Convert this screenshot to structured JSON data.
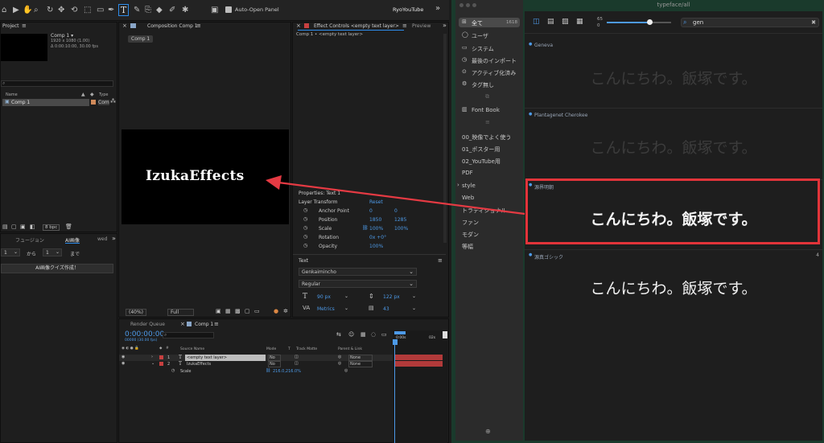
{
  "toolbar": {
    "auto_open_label": "Auto-Open Panel",
    "workspace_tab": "RyoYouTube",
    "more": "»"
  },
  "project": {
    "title": "Project",
    "comp_name": "Comp 1 ▾",
    "comp_dims": "1920 x 1080 (1.00)",
    "comp_duration": "Δ 0:00:10:00, 30.00 fps",
    "search_placeholder": "",
    "col_name": "Name",
    "col_type": "Type",
    "item_name": "Comp 1",
    "item_type": "Com",
    "bpc": "8 bpc"
  },
  "fusion_panel": {
    "tab1": "フュージョン",
    "tab2": "AI画像",
    "tab3": "wed",
    "more": "»",
    "from_val": "1",
    "from_label": "から",
    "to_val": "1",
    "to_label": "まで",
    "action": "AI画像クイズ作成！"
  },
  "composition": {
    "tab": "Composition Comp 1",
    "comp_chip": "Comp 1",
    "canvas_text": "IzukaEffects",
    "zoom": "(40%)",
    "quality": "Full"
  },
  "effect_controls": {
    "tab": "Effect Controls <empty text layer>",
    "preview_tab": "Preview",
    "breadcrumb": "Comp 1 • <empty text layer>"
  },
  "properties": {
    "title": "Properties: Text 1",
    "section": "Layer Transform",
    "reset": "Reset",
    "rows": [
      {
        "label": "Anchor Point",
        "v1": "0",
        "v2": "0"
      },
      {
        "label": "Position",
        "v1": "1850",
        "v2": "1285"
      },
      {
        "label": "Scale",
        "v1": "100%",
        "v2": "100%"
      },
      {
        "label": "Rotation",
        "v1": "0x +0°",
        "v2": ""
      },
      {
        "label": "Opacity",
        "v1": "100%",
        "v2": ""
      }
    ],
    "text_section": "Text",
    "font": "Genkaimincho",
    "style": "Regular",
    "size": "90 px",
    "leading": "122 px",
    "kerning": "Metrics",
    "tracking": "43"
  },
  "timeline": {
    "render_queue": "Render Queue",
    "comp_tab": "Comp 1",
    "timecode": "0:00:00:00",
    "frames": "00000 (30.00 fps)",
    "cols": {
      "source": "Source Name",
      "mode": "Mode",
      "t": "T",
      "matte": "Track Matte",
      "parent": "Parent & Link"
    },
    "ruler": [
      "0:00s",
      "02s"
    ],
    "layers": [
      {
        "num": "1",
        "name": "<empty text layer>",
        "mode": "No",
        "parent": "None"
      },
      {
        "num": "2",
        "name": "IzukaEffects",
        "mode": "No",
        "parent": "None"
      }
    ],
    "sub_label": "Scale",
    "sub_value": "216.0,216.0%"
  },
  "font_app": {
    "title": "typeface/all",
    "size_top": "65",
    "size_bottom": "0",
    "search_value": "gen",
    "sidebar": [
      {
        "label": "全て",
        "count": "1618"
      },
      {
        "label": "ユーザ",
        "count": ""
      },
      {
        "label": "システム",
        "count": ""
      },
      {
        "label": "最後のインポート",
        "count": ""
      },
      {
        "label": "アクティブ化済み",
        "count": ""
      },
      {
        "label": "タグ無し",
        "count": ""
      }
    ],
    "font_book": "Font Book",
    "collections": [
      "00_映像でよく使う",
      "01_ポスター用",
      "02_YouTube用",
      "PDF",
      "style",
      "Web",
      "トラディショナル",
      "ファン",
      "モダン",
      "等幅"
    ],
    "fonts": [
      {
        "name": "Geneva",
        "sample": "こんにちわ。飯塚です。"
      },
      {
        "name": "Plantagenet Cherokee",
        "sample": "こんにちわ。飯塚です。"
      },
      {
        "name": "源界明朝",
        "sample": "こんにちわ。飯塚です。"
      },
      {
        "name": "源真ゴシック",
        "sample": "こんにちわ。飯塚です。",
        "count": "4"
      }
    ]
  },
  "colors": {
    "highlight": "#e2343a",
    "accent": "#2d8ceb",
    "arrow": "#e53a43"
  }
}
